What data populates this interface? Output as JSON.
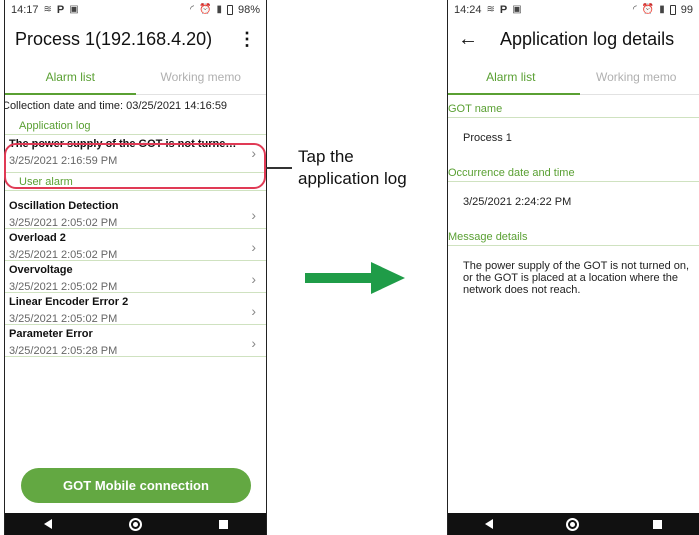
{
  "left": {
    "status": {
      "time": "14:17",
      "p": "P",
      "battery": "98%"
    },
    "title": "Process 1(192.168.4.20)",
    "tabs": [
      "Alarm list",
      "Working memo"
    ],
    "collection": "Collection date and time:  03/25/2021 14:16:59",
    "app_log_header": "Application log",
    "app_log": {
      "title": "The power supply of the GOT is not turned on, o...",
      "time": "3/25/2021 2:16:59 PM"
    },
    "user_alarm_header": "User alarm",
    "alarms": [
      {
        "title": "Oscillation Detection",
        "time": "3/25/2021 2:05:02 PM"
      },
      {
        "title": "Overload 2",
        "time": "3/25/2021 2:05:02 PM"
      },
      {
        "title": "Overvoltage",
        "time": "3/25/2021 2:05:02 PM"
      },
      {
        "title": "Linear Encoder Error 2",
        "time": "3/25/2021 2:05:02 PM"
      },
      {
        "title": "Parameter Error",
        "time": "3/25/2021 2:05:28 PM"
      }
    ],
    "connect_button": "GOT Mobile connection"
  },
  "callout": {
    "line1": "Tap the",
    "line2": "application log"
  },
  "right": {
    "status": {
      "time": "14:24",
      "p": "P",
      "battery": "99"
    },
    "title": "Application log details",
    "tabs": [
      "Alarm list",
      "Working memo"
    ],
    "got_name_label": "GOT name",
    "got_name": "Process 1",
    "occurrence_label": "Occurrence date and time",
    "occurrence": "3/25/2021 2:24:22 PM",
    "message_label": "Message details",
    "message": "The power supply of the GOT is not turned on, or the GOT is placed at a location where the network does not reach."
  },
  "colors": {
    "accent": "#5aa033",
    "button": "#63a842",
    "arrow": "#1f9c48",
    "highlight": "#e03a55"
  }
}
